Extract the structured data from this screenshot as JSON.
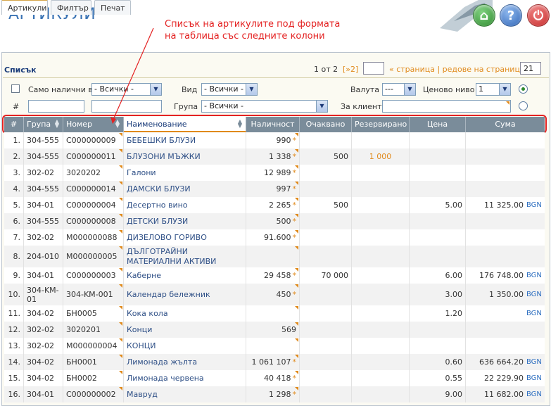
{
  "app": {
    "title": "АРТИКУЛИ"
  },
  "annotation": {
    "line1": "Списък на артикулите под формата",
    "line2": "на таблица със следните колони"
  },
  "tabs": [
    {
      "label": "Артикули",
      "active": true
    },
    {
      "label": "Филтър",
      "active": false
    },
    {
      "label": "Печат",
      "active": false
    }
  ],
  "list": {
    "title": "Списък",
    "page_count": "1 от 2",
    "next": "[»2]",
    "page_nav": "« страница | редове на страница »",
    "rows_per_page": "21"
  },
  "filters": {
    "only_available_label": "Само налични в",
    "only_available_value": "- Всички -",
    "type_label": "Вид",
    "type_value": "- Всички -",
    "currency_label": "Валута",
    "currency_value": "---",
    "price_level_label": "Ценово ниво",
    "price_level_value": "1",
    "hash_label": "#",
    "group_label": "Група",
    "group_value": "- Всички -",
    "client_label": "За клиент"
  },
  "columns": [
    "#",
    "Група",
    "Номер",
    "Наименование",
    "Наличност",
    "Очаквано",
    "Резервирано",
    "Цена",
    "Сума"
  ],
  "rows": [
    {
      "n": "1.",
      "group": "304-555",
      "num": "C000000009",
      "name": "БЕБЕШКИ БЛУЗИ",
      "stock": "990",
      "star": true,
      "expected": "",
      "reserved": "",
      "price": "",
      "sum": "",
      "cur": ""
    },
    {
      "n": "2.",
      "group": "304-555",
      "num": "C000000011",
      "name": "БЛУЗОНИ МЪЖКИ",
      "stock": "1 338",
      "star": true,
      "expected": "500",
      "reserved": "1 000",
      "price": "",
      "sum": "",
      "cur": ""
    },
    {
      "n": "3.",
      "group": "302-02",
      "num": "3020202",
      "name": "Галони",
      "stock": "12 989",
      "star": true,
      "expected": "",
      "reserved": "",
      "price": "",
      "sum": "",
      "cur": ""
    },
    {
      "n": "4.",
      "group": "304-555",
      "num": "C000000014",
      "name": "ДАМСКИ БЛУЗИ",
      "stock": "997",
      "star": true,
      "expected": "",
      "reserved": "",
      "price": "",
      "sum": "",
      "cur": ""
    },
    {
      "n": "5.",
      "group": "304-01",
      "num": "C000000004",
      "name": "Десертно вино",
      "stock": "2 265",
      "star": true,
      "expected": "500",
      "reserved": "",
      "price": "5.00",
      "sum": "11 325.00",
      "cur": "BGN"
    },
    {
      "n": "6.",
      "group": "304-555",
      "num": "C000000008",
      "name": "ДЕТСКИ БЛУЗИ",
      "stock": "500",
      "star": true,
      "expected": "",
      "reserved": "",
      "price": "",
      "sum": "",
      "cur": ""
    },
    {
      "n": "7.",
      "group": "302-02",
      "num": "M000000088",
      "name": "ДИЗЕЛОВО ГОРИВО",
      "stock": "91.600",
      "star": true,
      "expected": "",
      "reserved": "",
      "price": "",
      "sum": "",
      "cur": ""
    },
    {
      "n": "8.",
      "group": "204-010",
      "num": "M000000005",
      "name": "ДЪЛГОТРАЙНИ МАТЕРИАЛНИ АКТИВИ",
      "stock": "",
      "star": false,
      "expected": "",
      "reserved": "",
      "price": "",
      "sum": "",
      "cur": ""
    },
    {
      "n": "9.",
      "group": "304-01",
      "num": "C000000003",
      "name": "Каберне",
      "stock": "29 458",
      "star": true,
      "expected": "70 000",
      "reserved": "",
      "price": "6.00",
      "sum": "176 748.00",
      "cur": "BGN"
    },
    {
      "n": "10.",
      "group": "304-KM-01",
      "num": "304-KM-001",
      "name": "Календар бележник",
      "stock": "450",
      "star": true,
      "expected": "",
      "reserved": "",
      "price": "3.00",
      "sum": "1 350.00",
      "cur": "BGN"
    },
    {
      "n": "11.",
      "group": "304-02",
      "num": "БН0005",
      "name": "Кока кола",
      "stock": "",
      "star": false,
      "expected": "",
      "reserved": "",
      "price": "1.20",
      "sum": "",
      "cur": "BGN"
    },
    {
      "n": "12.",
      "group": "302-02",
      "num": "3020201",
      "name": "Конци",
      "stock": "569",
      "star": false,
      "expected": "",
      "reserved": "",
      "price": "",
      "sum": "",
      "cur": ""
    },
    {
      "n": "13.",
      "group": "302-02",
      "num": "M000000004",
      "name": "КОНЦИ",
      "stock": "",
      "star": false,
      "expected": "",
      "reserved": "",
      "price": "",
      "sum": "",
      "cur": ""
    },
    {
      "n": "14.",
      "group": "304-02",
      "num": "БН0001",
      "name": "Лимонада жълта",
      "stock": "1 061 107",
      "star": true,
      "expected": "",
      "reserved": "",
      "price": "0.60",
      "sum": "636 664.20",
      "cur": "BGN"
    },
    {
      "n": "15.",
      "group": "304-02",
      "num": "БН0002",
      "name": "Лимонада червена",
      "stock": "40 418",
      "star": true,
      "expected": "",
      "reserved": "",
      "price": "0.55",
      "sum": "22 229.90",
      "cur": "BGN"
    },
    {
      "n": "16.",
      "group": "304-01",
      "num": "C000000002",
      "name": "Мавруд",
      "stock": "1 298",
      "star": true,
      "expected": "",
      "reserved": "",
      "price": "9.00",
      "sum": "11 682.00",
      "cur": "BGN"
    }
  ]
}
